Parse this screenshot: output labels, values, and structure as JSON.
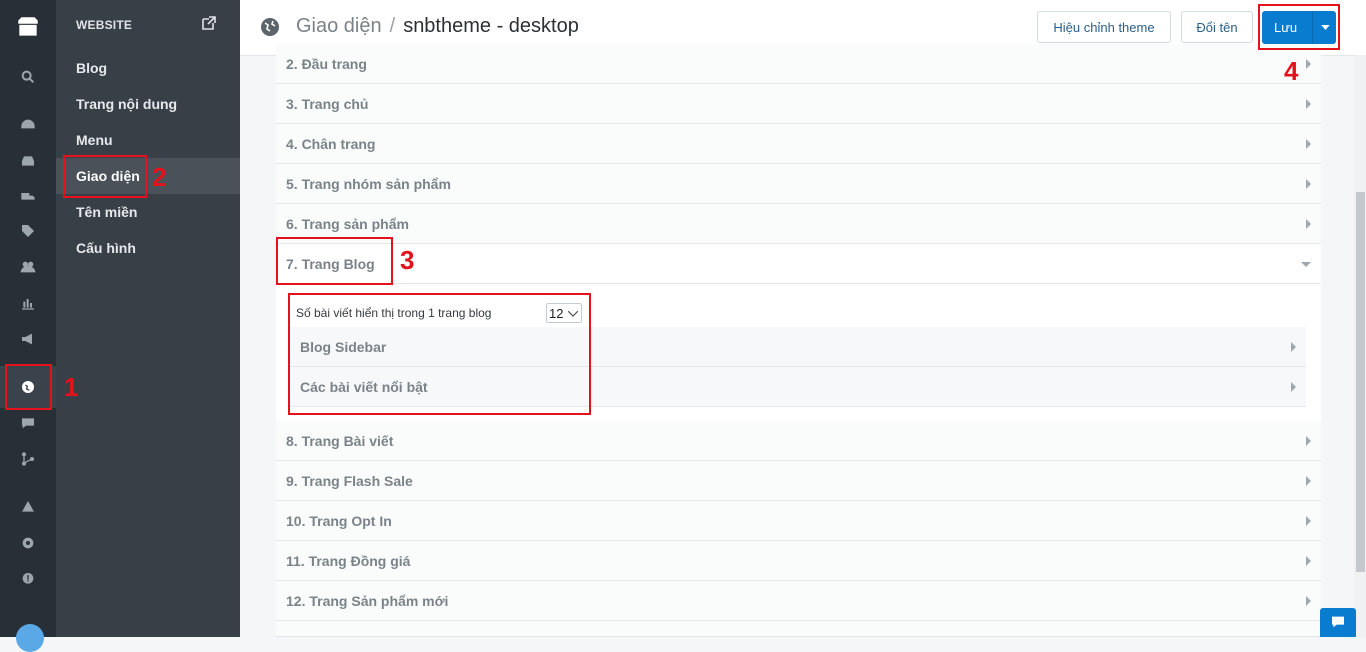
{
  "sidebar": {
    "header": "WEBSITE",
    "items": [
      {
        "label": "Blog"
      },
      {
        "label": "Trang nội dung"
      },
      {
        "label": "Menu"
      },
      {
        "label": "Giao diện",
        "active": true
      },
      {
        "label": "Tên miền"
      },
      {
        "label": "Cấu hình"
      }
    ]
  },
  "topbar": {
    "crumb_root": "Giao diện",
    "separator": "/",
    "crumb_current": "snbtheme - desktop",
    "edit_theme": "Hiệu chỉnh theme",
    "rename": "Đổi tên",
    "save": "Lưu"
  },
  "sections": [
    {
      "label": "2. Đầu trang"
    },
    {
      "label": "3. Trang chủ"
    },
    {
      "label": "4. Chân trang"
    },
    {
      "label": "5. Trang nhóm sản phẩm"
    },
    {
      "label": "6. Trang sản phẩm"
    },
    {
      "label": "7. Trang Blog",
      "expanded": true
    },
    {
      "label": "8. Trang Bài viết"
    },
    {
      "label": "9. Trang Flash Sale"
    },
    {
      "label": "10. Trang Opt In"
    },
    {
      "label": "11. Trang Đồng giá"
    },
    {
      "label": "12. Trang Sản phẩm mới"
    }
  ],
  "blog_settings": {
    "posts_per_page_label": "Số bài viết hiển thị trong 1 trang blog",
    "posts_per_page_value": "12",
    "subsections": [
      {
        "label": "Blog Sidebar"
      },
      {
        "label": "Các bài viết nổi bật"
      }
    ]
  },
  "annotations": [
    "1",
    "2",
    "3",
    "4"
  ],
  "colors": {
    "accent": "#0a7ccf",
    "annotation_red": "#e3121b",
    "rail_bg": "#292f36",
    "subsidebar_bg": "#393f46"
  }
}
